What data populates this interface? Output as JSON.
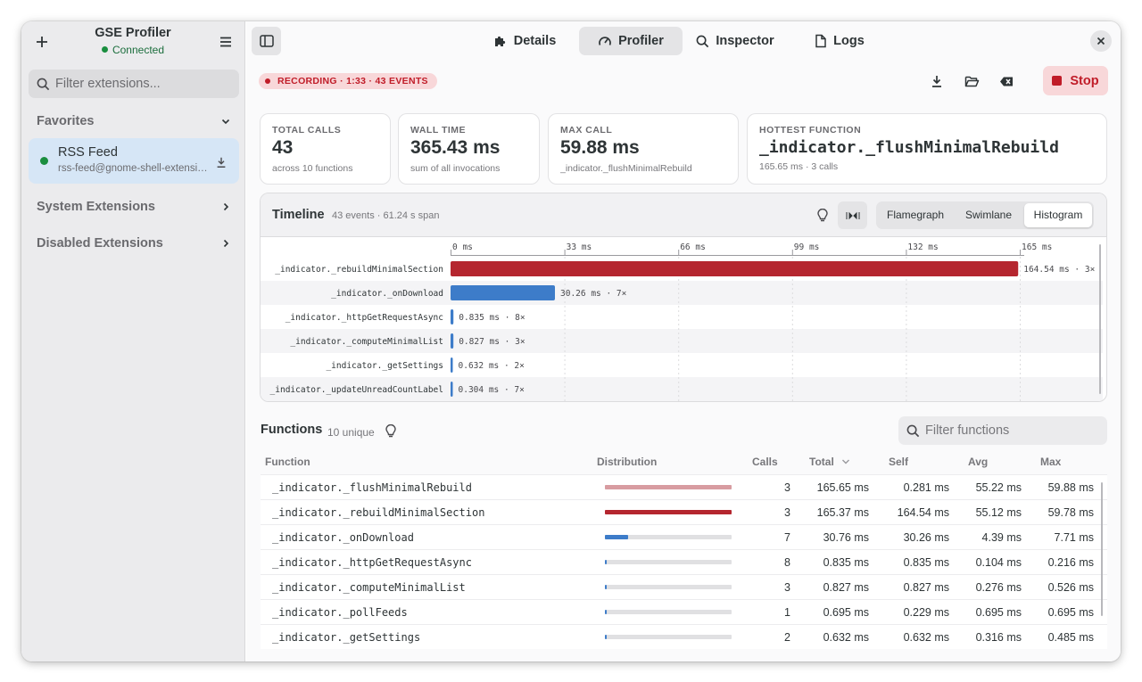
{
  "app": {
    "title": "GSE Profiler",
    "status": "Connected"
  },
  "sidebar": {
    "search_placeholder": "Filter extensions...",
    "favorites_label": "Favorites",
    "favorite_item": {
      "name": "RSS Feed",
      "id": "rss-feed@gnome-shell-extensions..."
    },
    "system_label": "System Extensions",
    "disabled_label": "Disabled Extensions"
  },
  "header": {
    "tabs": [
      {
        "label": "Details",
        "icon": "puzzle-icon"
      },
      {
        "label": "Profiler",
        "icon": "gauge-icon"
      },
      {
        "label": "Inspector",
        "icon": "search-icon"
      },
      {
        "label": "Logs",
        "icon": "file-icon"
      }
    ],
    "active_tab": "Profiler"
  },
  "toolbar": {
    "recording_label": "RECORDING · 1:33 · 43 EVENTS",
    "stop_label": "Stop"
  },
  "cards": [
    {
      "label": "TOTAL CALLS",
      "value": "43",
      "sub": "across 10 functions"
    },
    {
      "label": "WALL TIME",
      "value": "365.43 ms",
      "sub": "sum of all invocations"
    },
    {
      "label": "MAX CALL",
      "value": "59.88 ms",
      "sub": "_indicator._flushMinimalRebuild"
    },
    {
      "label": "HOTTEST FUNCTION",
      "value": "_indicator._flushMinimalRebuild",
      "sub": "165.65 ms · 3 calls"
    }
  ],
  "timeline": {
    "title": "Timeline",
    "meta": "43 events · 61.24 s span",
    "modes": [
      "Flamegraph",
      "Swimlane",
      "Histogram"
    ],
    "active_mode": "Histogram"
  },
  "chart_data": {
    "type": "bar",
    "orientation": "horizontal",
    "axis_ticks": [
      "0 ms",
      "33 ms",
      "66 ms",
      "99 ms",
      "132 ms",
      "165 ms"
    ],
    "xlim": [
      0,
      165
    ],
    "colors": {
      "hot": "#b5262f",
      "normal": "#3d7cc9"
    },
    "series": [
      {
        "name": "_indicator._rebuildMinimalSection",
        "value": 164.54,
        "label": "164.54 ms · 3×",
        "hot": true
      },
      {
        "name": "_indicator._onDownload",
        "value": 30.26,
        "label": "30.26 ms · 7×",
        "hot": false
      },
      {
        "name": "_indicator._httpGetRequestAsync",
        "value": 0.835,
        "label": "0.835 ms · 8×",
        "hot": false
      },
      {
        "name": "_indicator._computeMinimalList",
        "value": 0.827,
        "label": "0.827 ms · 3×",
        "hot": false
      },
      {
        "name": "_indicator._getSettings",
        "value": 0.632,
        "label": "0.632 ms · 2×",
        "hot": false
      },
      {
        "name": "_indicator._updateUnreadCountLabel",
        "value": 0.304,
        "label": "0.304 ms · 7×",
        "hot": false
      }
    ]
  },
  "functions": {
    "title": "Functions",
    "meta": "10 unique",
    "search_placeholder": "Filter functions",
    "columns": [
      "Function",
      "Distribution",
      "Calls",
      "Total",
      "Self",
      "Avg",
      "Max"
    ],
    "dist_max": 165.65,
    "rows": [
      {
        "name": "_indicator._flushMinimalRebuild",
        "dist": 165.65,
        "dist_color": "#d89ca1",
        "calls": "3",
        "total": "165.65 ms",
        "self": "0.281 ms",
        "avg": "55.22 ms",
        "max": "59.88 ms"
      },
      {
        "name": "_indicator._rebuildMinimalSection",
        "dist": 165.37,
        "dist_color": "#b5262f",
        "calls": "3",
        "total": "165.37 ms",
        "self": "164.54 ms",
        "avg": "55.12 ms",
        "max": "59.78 ms"
      },
      {
        "name": "_indicator._onDownload",
        "dist": 30.76,
        "dist_color": "#3d7cc9",
        "calls": "7",
        "total": "30.76 ms",
        "self": "30.26 ms",
        "avg": "4.39 ms",
        "max": "7.71 ms"
      },
      {
        "name": "_indicator._httpGetRequestAsync",
        "dist": 0.835,
        "dist_color": "#3d7cc9",
        "calls": "8",
        "total": "0.835 ms",
        "self": "0.835 ms",
        "avg": "0.104 ms",
        "max": "0.216 ms"
      },
      {
        "name": "_indicator._computeMinimalList",
        "dist": 0.827,
        "dist_color": "#3d7cc9",
        "calls": "3",
        "total": "0.827 ms",
        "self": "0.827 ms",
        "avg": "0.276 ms",
        "max": "0.526 ms"
      },
      {
        "name": "_indicator._pollFeeds",
        "dist": 0.695,
        "dist_color": "#3d7cc9",
        "calls": "1",
        "total": "0.695 ms",
        "self": "0.229 ms",
        "avg": "0.695 ms",
        "max": "0.695 ms"
      },
      {
        "name": "_indicator._getSettings",
        "dist": 0.632,
        "dist_color": "#3d7cc9",
        "calls": "2",
        "total": "0.632 ms",
        "self": "0.632 ms",
        "avg": "0.316 ms",
        "max": "0.485 ms"
      }
    ]
  }
}
